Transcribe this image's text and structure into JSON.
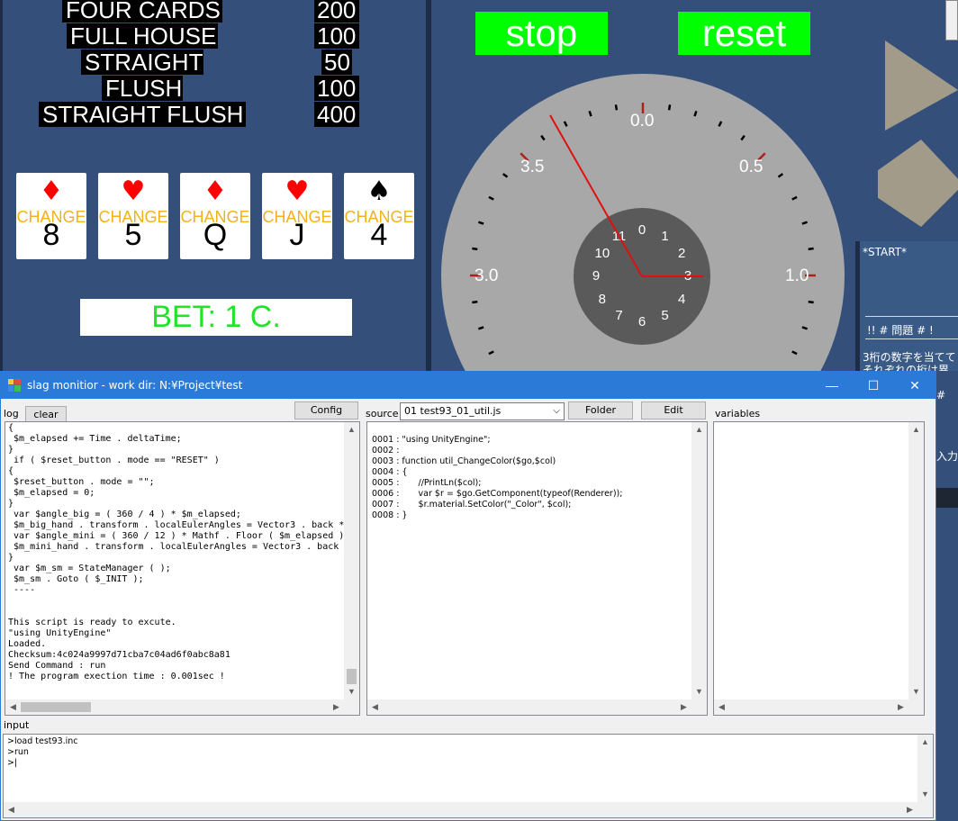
{
  "game": {
    "paytable": [
      {
        "name": "FOUR CARDS",
        "value": "200"
      },
      {
        "name": "FULL HOUSE",
        "value": "100"
      },
      {
        "name": "STRAIGHT",
        "value": "50"
      },
      {
        "name": "FLUSH",
        "value": "100"
      },
      {
        "name": "STRAIGHT FLUSH",
        "value": "400"
      }
    ],
    "cards": [
      {
        "suit": "♦",
        "suit_color": "#ff0000",
        "change": "CHANGE",
        "rank": "8"
      },
      {
        "suit": "♥",
        "suit_color": "#ff0000",
        "change": "CHANGE",
        "rank": "5"
      },
      {
        "suit": "♦",
        "suit_color": "#ff0000",
        "change": "CHANGE",
        "rank": "Q"
      },
      {
        "suit": "♥",
        "suit_color": "#ff0000",
        "change": "CHANGE",
        "rank": "J"
      },
      {
        "suit": "♠",
        "suit_color": "#000000",
        "change": "CHANGE",
        "rank": "4"
      }
    ],
    "bet": "BET: 1 C.",
    "stop_label": "stop",
    "reset_label": "reset",
    "big_dial_labels": [
      "0.0",
      "0.5",
      "1.0",
      "3.0",
      "3.5"
    ],
    "mini_dial_labels": [
      "0",
      "1",
      "2",
      "3",
      "4",
      "5",
      "6",
      "7",
      "8",
      "9",
      "10",
      "11"
    ],
    "side_panel": {
      "start": "*START*",
      "header": "!! # 問題 # !",
      "line1": "3桁の数字を当てて",
      "line2": "それぞれの桁は異",
      "frag1": "#",
      "frag2": "入力"
    }
  },
  "window": {
    "title": "slag monitior - work dir: N:¥Project¥test",
    "controls": {
      "minimize": "—",
      "maximize": "☐",
      "close": "✕"
    },
    "log_label": "log",
    "clear_button": "clear",
    "config_button": "Config",
    "source_label": "source",
    "source_select": "01 test93_01_util.js",
    "folder_button": "Folder",
    "edit_button": "Edit",
    "variables_label": "variables",
    "input_label": "input",
    "log_lines": [
      "{",
      " $m_elapsed += Time . deltaTime;",
      "}",
      " if ( $reset_button . mode == \"RESET\" )",
      "{",
      " $reset_button . mode = \"\";",
      " $m_elapsed = 0;",
      "}",
      " var $angle_big = ( 360 / 4 ) * $m_elapsed;",
      " $m_big_hand . transform . localEulerAngles = Vector3 . back *",
      " var $angle_mini = ( 360 / 12 ) * Mathf . Floor ( $m_elapsed )",
      " $m_mini_hand . transform . localEulerAngles = Vector3 . back",
      "}",
      " var $m_sm = StateManager ( );",
      " $m_sm . Goto ( $_INIT );",
      " ----",
      "",
      "",
      "This script is ready to excute.",
      "\"using UnityEngine\"",
      "Loaded.",
      "Checksum:4c024a9997d71cba7c04ad6f0abc8a81",
      "Send Command : run",
      "! The program exection time : 0.001sec !"
    ],
    "source_lines": [
      "0001 : \"using UnityEngine\";",
      "0002 :",
      "0003 : function util_ChangeColor($go,$col)",
      "0004 : {",
      "0005 :       //PrintLn($col);",
      "0006 :       var $r = $go.GetComponent(typeof(Renderer));",
      "0007 :       $r.material.SetColor(\"_Color\", $col);",
      "0008 : }"
    ],
    "input_lines": [
      ">load test93.inc",
      ">run",
      ">|"
    ]
  },
  "colors": {
    "game_bg": "#34507a",
    "button_green": "#00ff00",
    "titlebar": "#2b7ad8",
    "change_text": "#f2b21c",
    "bet_text": "#22e32a",
    "hand_red": "#e01010"
  }
}
